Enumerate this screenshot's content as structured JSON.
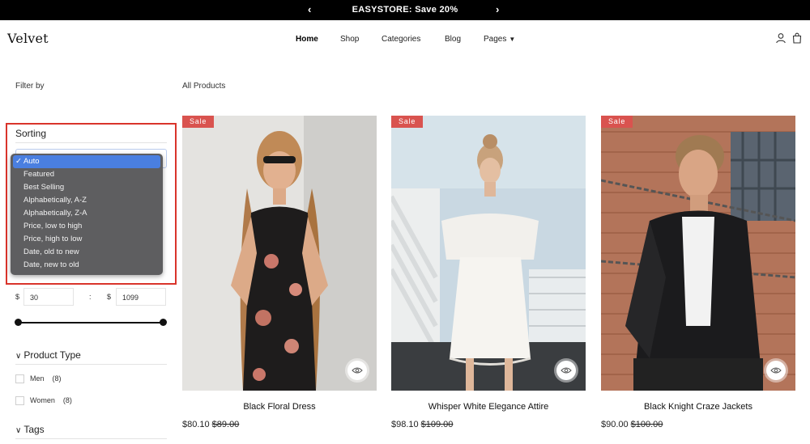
{
  "announcement": {
    "text": "EASYSTORE: Save 20%",
    "prev_icon": "chevron-left-icon",
    "next_icon": "chevron-right-icon"
  },
  "header": {
    "logo": "Velvet",
    "nav": [
      "Home",
      "Shop",
      "Categories",
      "Blog",
      "Pages"
    ],
    "icons": [
      "user-icon",
      "shopping-bag-icon"
    ]
  },
  "sidebar": {
    "filter_by": "Filter by",
    "sorting": {
      "title": "Sorting",
      "selected": "Auto",
      "options": [
        "Auto",
        "Featured",
        "Best Selling",
        "Alphabetically, A-Z",
        "Alphabetically, Z-A",
        "Price, low to high",
        "Price, high to low",
        "Date, old to new",
        "Date, new to old"
      ]
    },
    "price": {
      "currency": "$",
      "min": "30",
      "max": "1099",
      "separator": ":"
    },
    "product_type": {
      "title": "Product Type",
      "items": [
        {
          "label": "Men",
          "count": "(8)"
        },
        {
          "label": "Women",
          "count": "(8)"
        }
      ]
    },
    "tags": {
      "title": "Tags"
    }
  },
  "main": {
    "heading": "All Products",
    "products": [
      {
        "badge": "Sale",
        "name": "Black Floral Dress",
        "price": "$80.10",
        "compare_price": "$89.00"
      },
      {
        "badge": "Sale",
        "name": "Whisper White Elegance Attire",
        "price": "$98.10",
        "compare_price": "$109.00"
      },
      {
        "badge": "Sale",
        "name": "Black Knight Craze Jackets",
        "price": "$90.00",
        "compare_price": "$100.00"
      }
    ]
  },
  "colors": {
    "accent_sale": "#d9534f",
    "highlight_border": "#d9342b",
    "dropdown_selected": "#4a7fe0"
  }
}
